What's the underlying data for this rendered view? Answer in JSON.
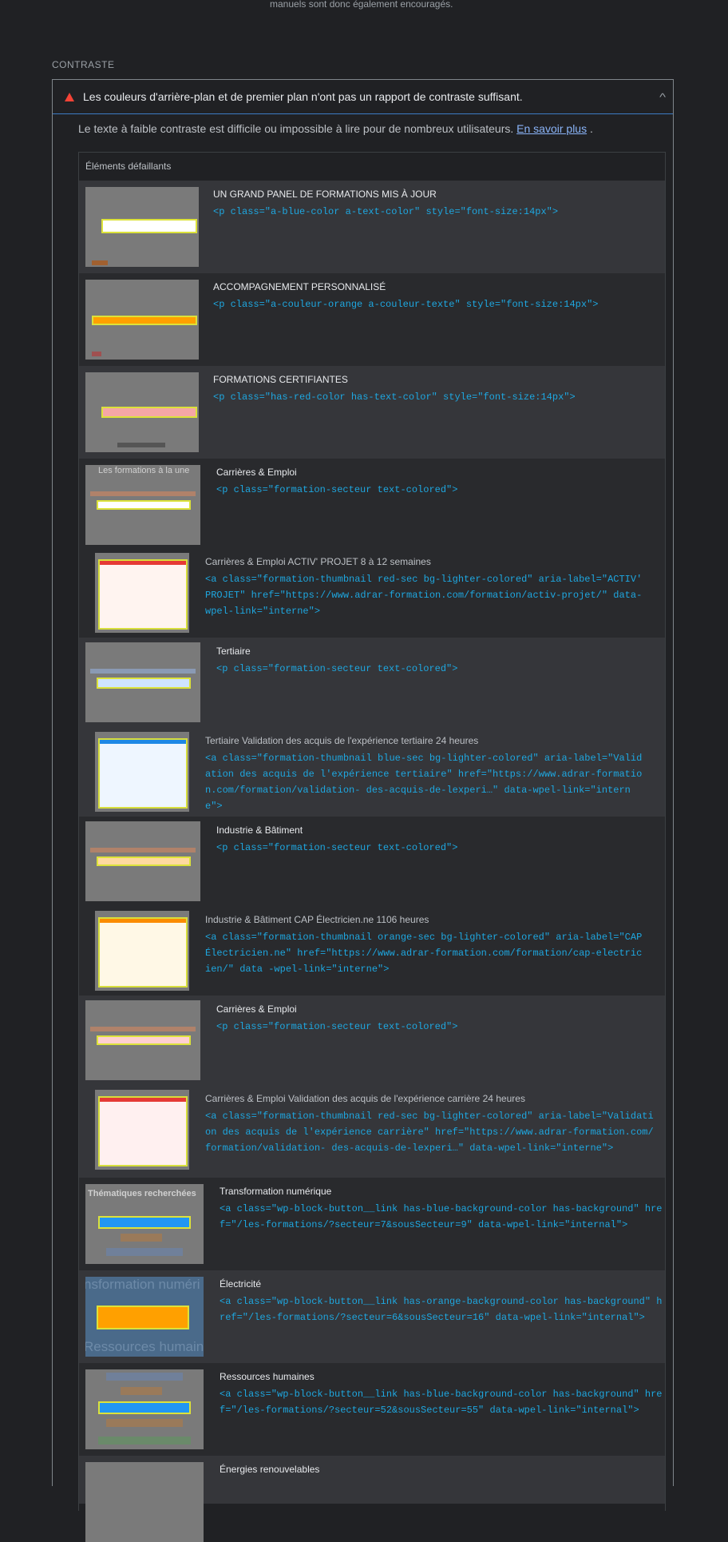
{
  "top_note": "manuels sont donc également encouragés.",
  "section_title": "CONTRASTE",
  "audit": {
    "title": "Les couleurs d'arrière-plan et de premier plan n'ont pas un rapport de contraste suffisant.",
    "description": "Le texte à faible contraste est difficile ou impossible à lire pour de nombreux utilisateurs.",
    "learn_more": "En savoir plus",
    "period": ".",
    "table_header": "Éléments défaillants"
  },
  "thumb_text": {
    "les_formations": "Les formations à la une",
    "thematiques": "Thématiques recherchées",
    "transformation_big": "nsformation numéri",
    "ressources_big": "Ressources humaine"
  },
  "rows": [
    {
      "label": "UN GRAND PANEL DE FORMATIONS MIS À JOUR",
      "code": "<p class=\"a-blue-color a-text-color\" style=\"font-size:14px\">"
    },
    {
      "label": "ACCOMPAGNEMENT PERSONNALISÉ",
      "code": "<p class=\"a-couleur-orange a-couleur-texte\" style=\"font-size:14px\">"
    },
    {
      "label": "FORMATIONS CERTIFIANTES",
      "code": "<p class=\"has-red-color has-text-color\" style=\"font-size:14px\">"
    },
    {
      "label": "Carrières & Emploi",
      "code": "<p class=\"formation-secteur text-colored\">"
    },
    {
      "label": "Carrières & Emploi ACTIV' PROJET 8 à 12 semaines",
      "code": "<a class=\"formation-thumbnail red-sec bg-lighter-colored\" aria-label=\"ACTIV' PROJET\" href=\"https://www.adrar-formation.com/formation/activ-projet/\" data-wpel-link=\"interne\">"
    },
    {
      "label": "Tertiaire",
      "code": "<p class=\"formation-secteur text-colored\">"
    },
    {
      "label": "Tertiaire Validation des acquis de l'expérience tertiaire 24 heures",
      "code": "<a class=\"formation-thumbnail blue-sec bg-lighter-colored\" aria-label=\"Validation des acquis de l'expérience tertiaire\" href=\"https://www.adrar-formation.com/formation/validation- des-acquis-de-lexperi…\" data-wpel-link=\"interne\">"
    },
    {
      "label": "Industrie & Bâtiment",
      "code": "<p class=\"formation-secteur text-colored\">"
    },
    {
      "label": "Industrie & Bâtiment CAP Électricien.ne 1106 heures",
      "code": "<a class=\"formation-thumbnail orange-sec bg-lighter-colored\" aria-label=\"CAP Électricien.ne\" href=\"https://www.adrar-formation.com/formation/cap-electricien/\" data -wpel-link=\"interne\">"
    },
    {
      "label": "Carrières & Emploi",
      "code": "<p class=\"formation-secteur text-colored\">"
    },
    {
      "label": "Carrières & Emploi Validation des acquis de l'expérience carrière 24 heures",
      "code": "<a class=\"formation-thumbnail red-sec bg-lighter-colored\" aria-label=\"Validation des acquis de l'expérience carrière\" href=\"https://www.adrar-formation.com/formation/validation- des-acquis-de-lexperi…\" data-wpel-link=\"interne\">"
    },
    {
      "label": "Transformation numérique",
      "code": "<a class=\"wp-block-button__link has-blue-background-color has-background\" href=\"/les-formations/?secteur=7&sousSecteur=9\" data-wpel-link=\"internal\">"
    },
    {
      "label": "Électricité",
      "code": "<a class=\"wp-block-button__link has-orange-background-color has-background\" href=\"/les-formations/?secteur=6&sousSecteur=16\" data-wpel-link=\"internal\">"
    },
    {
      "label": "Ressources humaines",
      "code": "<a class=\"wp-block-button__link has-blue-background-color has-background\" href=\"/les-formations/?secteur=52&sousSecteur=55\" data-wpel-link=\"internal\">"
    },
    {
      "label": "Énergies renouvelables",
      "code": ""
    }
  ]
}
